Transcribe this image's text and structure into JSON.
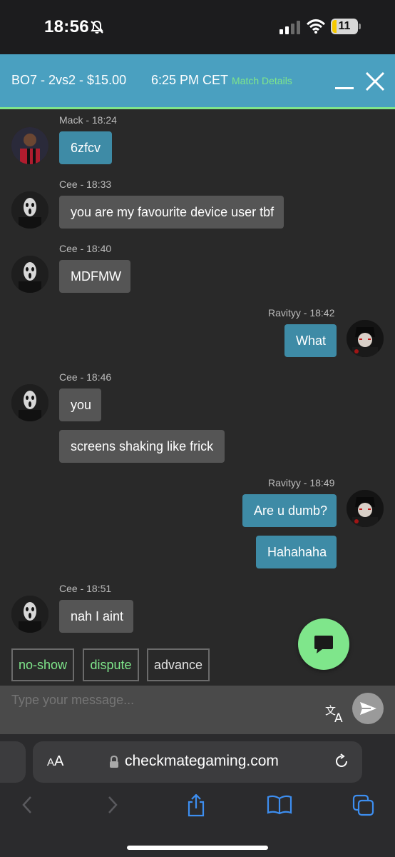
{
  "status_bar": {
    "time": "18:56",
    "battery": "11"
  },
  "header": {
    "match_title": "BO7 - 2vs2 - $15.00",
    "match_time": "6:25 PM CET",
    "match_details": "Match Details"
  },
  "messages": [
    {
      "meta": "Mack - 18:24",
      "text": "6zfcv"
    },
    {
      "meta": "Cee - 18:33",
      "text": "you are my favourite device user tbf"
    },
    {
      "meta": "Cee - 18:40",
      "text": "MDFMW"
    },
    {
      "meta": "Ravityy - 18:42",
      "text": "What"
    },
    {
      "meta": "Cee - 18:46",
      "text": "you",
      "text2": "screens shaking like frick"
    },
    {
      "meta": "Ravityy - 18:49",
      "text": "Are u dumb?",
      "text2": "Hahahaha"
    },
    {
      "meta": "Cee - 18:51",
      "text": "nah I aint"
    }
  ],
  "actions": {
    "no_show": "no-show",
    "dispute": "dispute",
    "advance": "advance"
  },
  "input": {
    "placeholder": "Type your message..."
  },
  "browser": {
    "aa_small": "A",
    "aa_large": "A",
    "url": "checkmategaming.com"
  },
  "colors": {
    "accent": "#4aa0c0",
    "green": "#7fe68b",
    "bubble_grey": "#555555",
    "bubble_blue": "#3e8ba6"
  }
}
